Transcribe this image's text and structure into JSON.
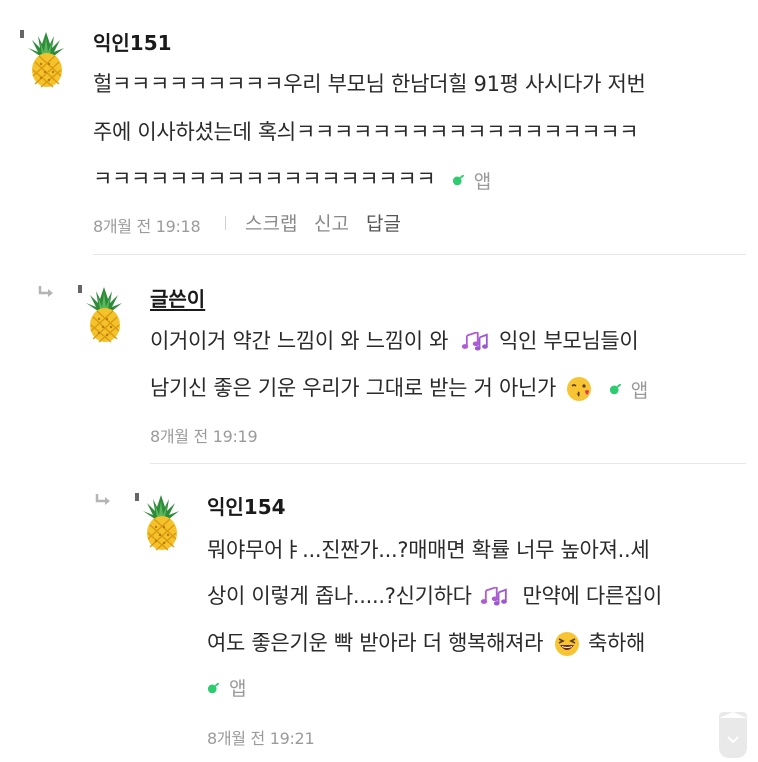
{
  "comments": [
    {
      "author": "익인151",
      "lines": [
        "헐ㅋㅋㅋㅋㅋㅋㅋㅋㅋ우리 부모님 한남더힐 91평 사시다가 저번",
        "주에 이사하셨는데 혹싀ㅋㅋㅋㅋㅋㅋㅋㅋㅋㅋㅋㅋㅋㅋㅋㅋㅋㅋ",
        "ㅋㅋㅋㅋㅋㅋㅋㅋㅋㅋㅋㅋㅋㅋㅋㅋㅋㅋ"
      ],
      "app_label": "앱",
      "time": "8개월 전 19:18",
      "actions": {
        "scrap": "스크랩",
        "report": "신고",
        "reply": "답글"
      }
    },
    {
      "author": "글쓴이",
      "lines": [
        "이거이거 약간 느낌이 와 느낌이 와",
        "익인 부모님들이",
        "남기신 좋은 기운 우리가 그대로 받는 거 아닌가"
      ],
      "app_label": "앱",
      "time": "8개월 전 19:19"
    },
    {
      "author": "익인154",
      "lines": [
        "뭐야무어ㅑ...진짠가...?매매면 확률 너무 높아져..세",
        "상이 이렇게 좁나.....?신기하다",
        "만약에 다른집이",
        "여도 좋은기운 빡 받아라 더 행복해져라",
        "축하해"
      ],
      "app_label": "앱",
      "time": "8개월 전 19:21"
    }
  ],
  "colors": {
    "app_leaf": "#2ecc71",
    "meta_text": "#9b9b9b",
    "divider": "#e6e6e6"
  },
  "icons": [
    "pineapple-avatar-icon",
    "reply-arrow-icon",
    "app-leaf-icon",
    "music-notes-icon",
    "kiss-emoji-icon",
    "laughing-emoji-icon",
    "chevron-down-icon"
  ]
}
